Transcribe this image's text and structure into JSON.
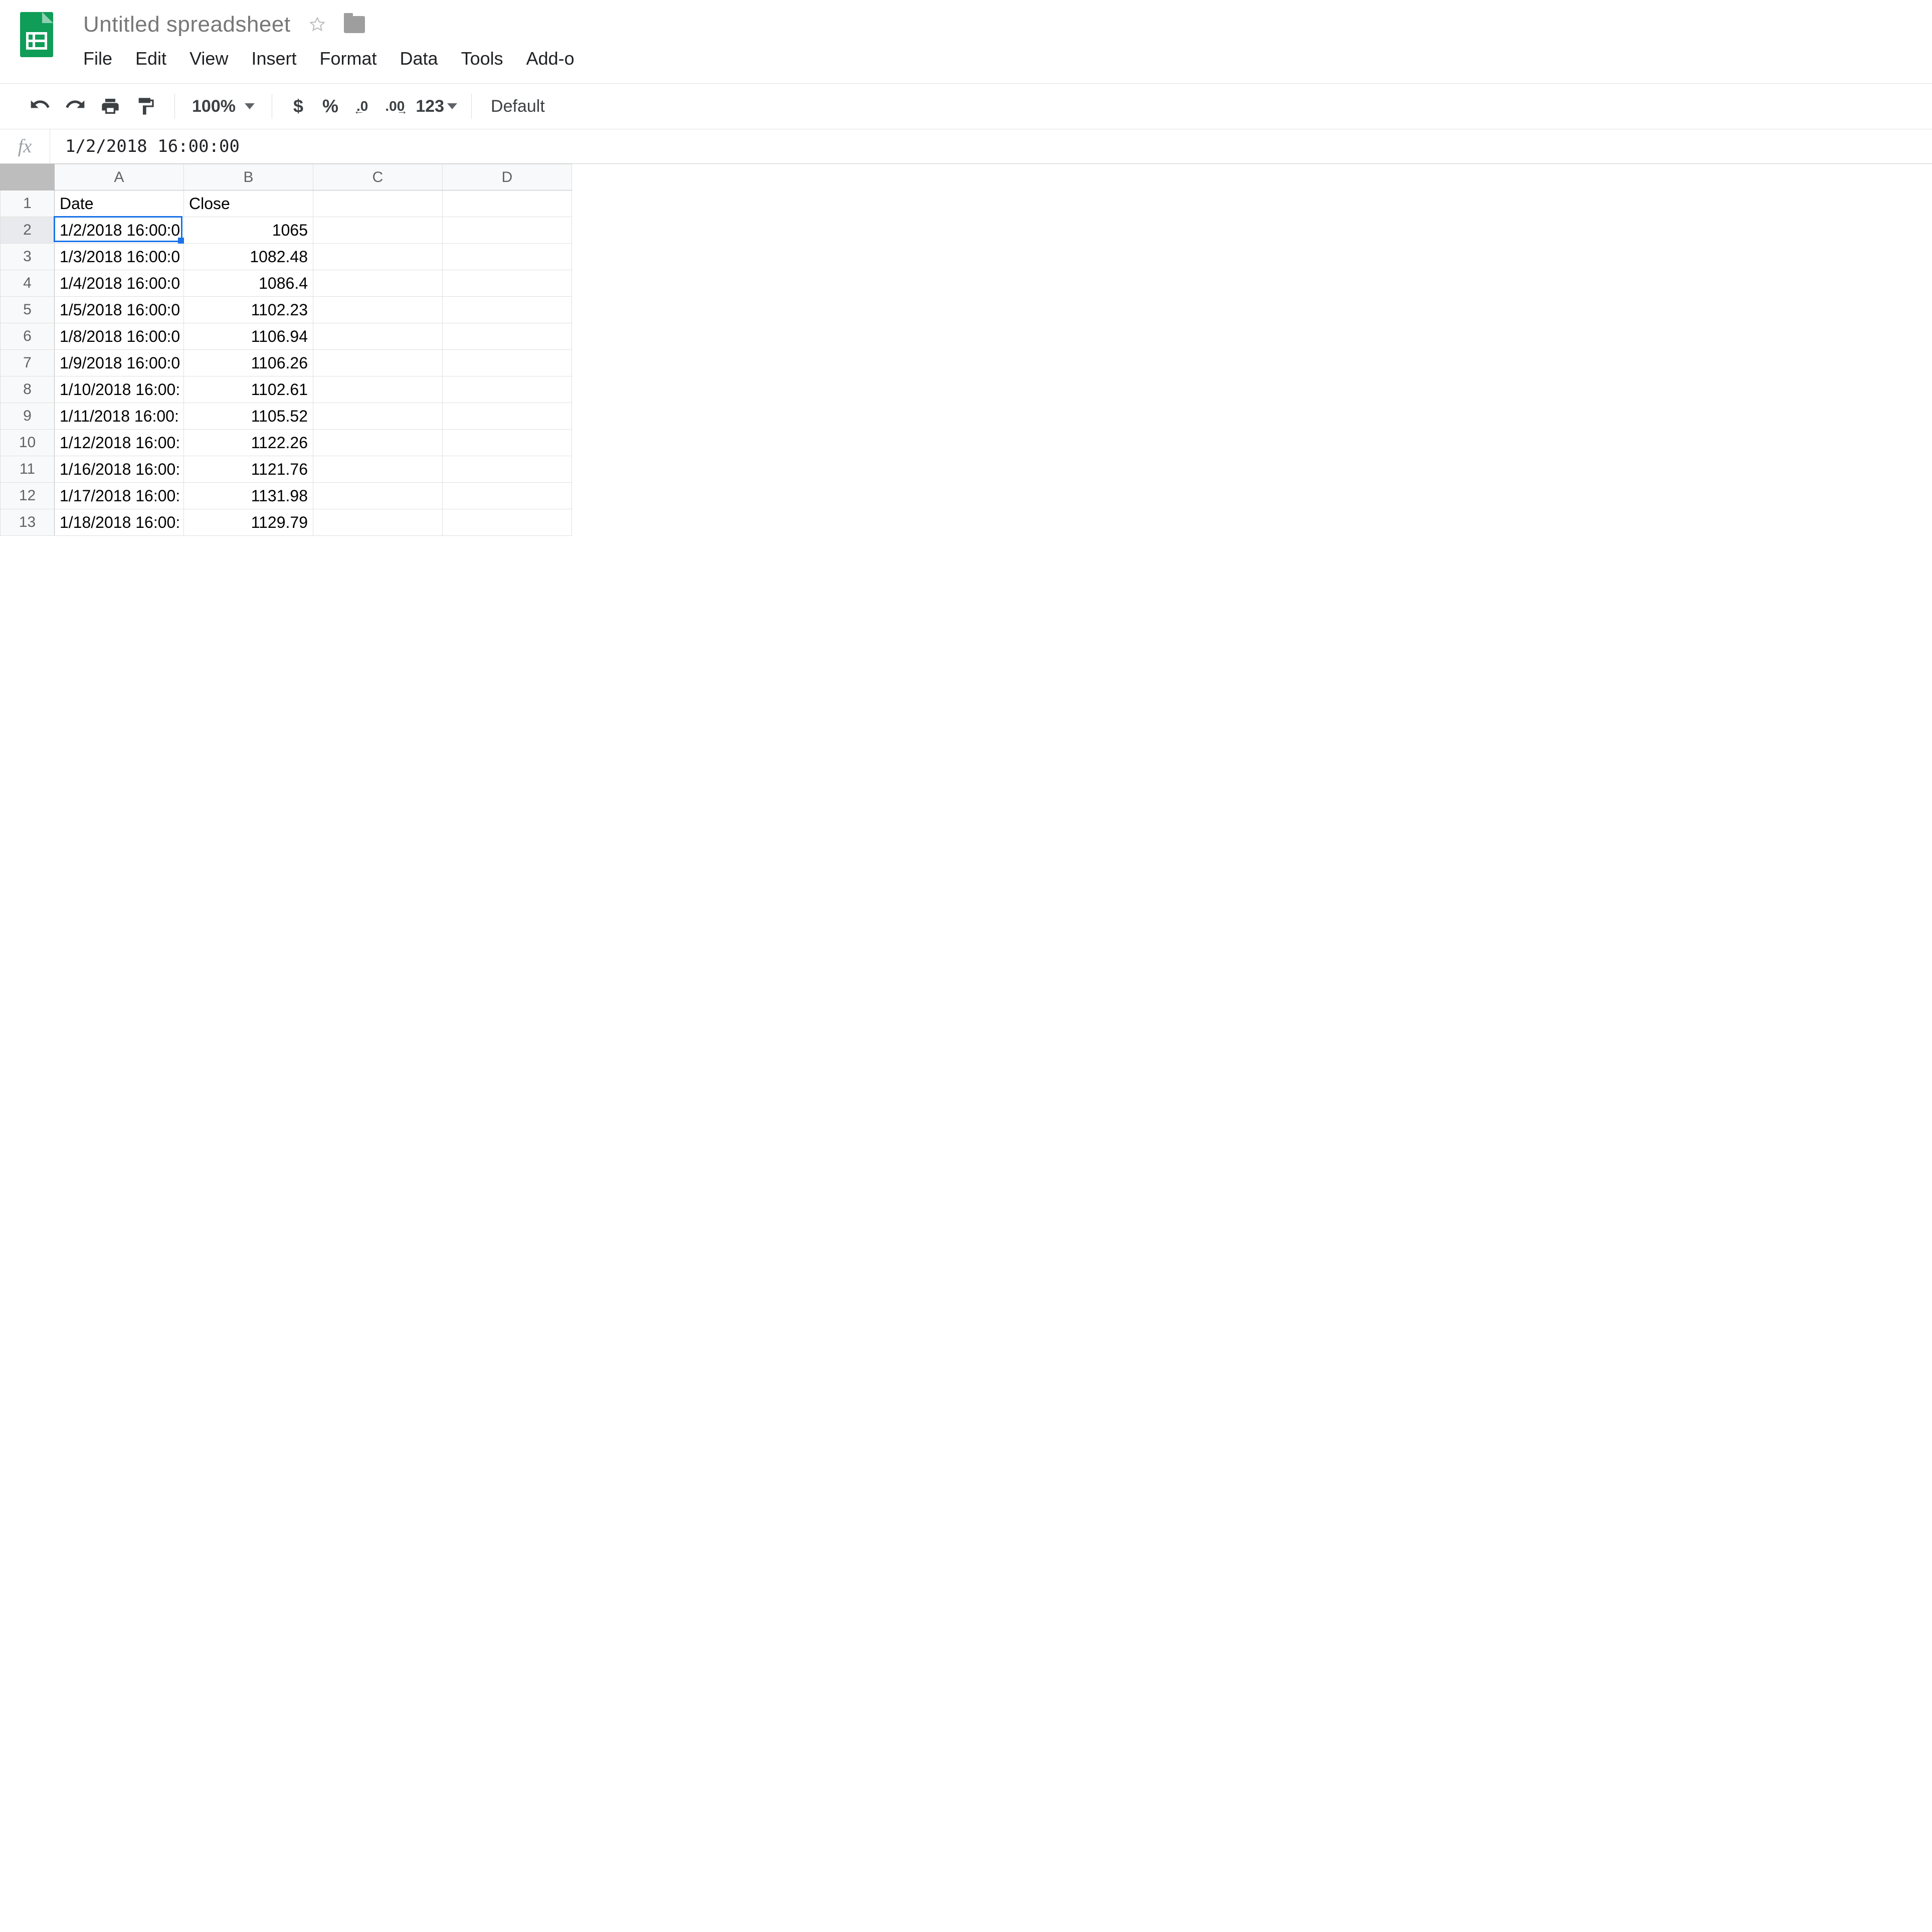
{
  "header": {
    "title": "Untitled spreadsheet",
    "menu": [
      "File",
      "Edit",
      "View",
      "Insert",
      "Format",
      "Data",
      "Tools",
      "Add-o"
    ]
  },
  "toolbar": {
    "zoom": "100%",
    "currency": "$",
    "percent": "%",
    "dec0": ".0",
    "dec00": ".00",
    "fmt123": "123",
    "font": "Default"
  },
  "formula_bar": {
    "label": "fx",
    "value": "1/2/2018 16:00:00"
  },
  "columns": [
    "A",
    "B",
    "C",
    "D"
  ],
  "selected_cell": "A2",
  "rows": [
    {
      "n": "1",
      "A": "Date",
      "B": "Close",
      "alignB": "left"
    },
    {
      "n": "2",
      "A": "1/2/2018 16:00:0",
      "B": "1065",
      "alignB": "right"
    },
    {
      "n": "3",
      "A": "1/3/2018 16:00:0",
      "B": "1082.48",
      "alignB": "right"
    },
    {
      "n": "4",
      "A": "1/4/2018 16:00:0",
      "B": "1086.4",
      "alignB": "right"
    },
    {
      "n": "5",
      "A": "1/5/2018 16:00:0",
      "B": "1102.23",
      "alignB": "right"
    },
    {
      "n": "6",
      "A": "1/8/2018 16:00:0",
      "B": "1106.94",
      "alignB": "right"
    },
    {
      "n": "7",
      "A": "1/9/2018 16:00:0",
      "B": "1106.26",
      "alignB": "right"
    },
    {
      "n": "8",
      "A": "1/10/2018 16:00:",
      "B": "1102.61",
      "alignB": "right"
    },
    {
      "n": "9",
      "A": "1/11/2018 16:00:",
      "B": "1105.52",
      "alignB": "right"
    },
    {
      "n": "10",
      "A": "1/12/2018 16:00:",
      "B": "1122.26",
      "alignB": "right"
    },
    {
      "n": "11",
      "A": "1/16/2018 16:00:",
      "B": "1121.76",
      "alignB": "right"
    },
    {
      "n": "12",
      "A": "1/17/2018 16:00:",
      "B": "1131.98",
      "alignB": "right"
    },
    {
      "n": "13",
      "A": "1/18/2018 16:00:",
      "B": "1129.79",
      "alignB": "right"
    }
  ]
}
